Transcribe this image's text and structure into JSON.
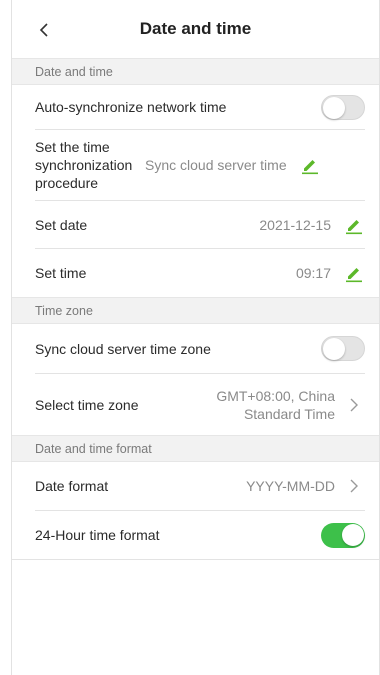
{
  "header": {
    "title": "Date and time"
  },
  "sections": {
    "date_time": "Date and time",
    "time_zone": "Time zone",
    "format": "Date and time format"
  },
  "rows": {
    "auto_sync": {
      "label": "Auto-synchronize network time",
      "enabled": false
    },
    "sync_procedure": {
      "label": "Set the time synchronization procedure",
      "value": "Sync cloud server time"
    },
    "set_date": {
      "label": "Set date",
      "value": "2021-12-15"
    },
    "set_time": {
      "label": "Set time",
      "value": "09:17"
    },
    "sync_tz": {
      "label": "Sync cloud server time zone",
      "enabled": false
    },
    "select_tz": {
      "label": "Select time zone",
      "value": "GMT+08:00, China Standard Time"
    },
    "date_format": {
      "label": "Date format",
      "value": "YYYY-MM-DD"
    },
    "hour24": {
      "label": "24-Hour time format",
      "enabled": true
    }
  },
  "colors": {
    "accent": "#3dc04a",
    "edit_icon": "#5cb82a"
  },
  "icons": {
    "back": "chevron-left-icon",
    "edit": "pencil-icon",
    "more": "chevron-right-icon"
  }
}
